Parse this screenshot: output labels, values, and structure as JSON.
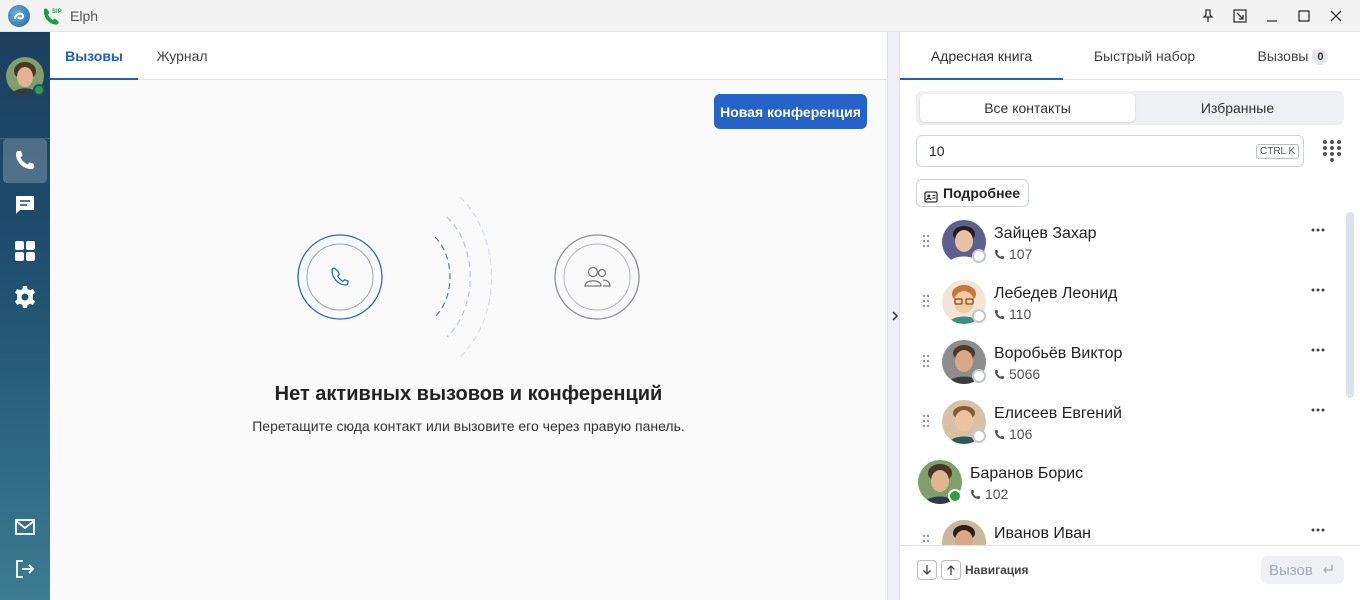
{
  "window": {
    "title": "Elph"
  },
  "center": {
    "tabs": [
      {
        "label": "Вызовы"
      },
      {
        "label": "Журнал"
      }
    ],
    "new_conference_label": "Новая конференция",
    "empty_title": "Нет активных вызовов и конференций",
    "empty_subtitle": "Перетащите сюда контакт или вызовите его через правую панель."
  },
  "right": {
    "tabs": [
      {
        "label": "Адресная книга"
      },
      {
        "label": "Быстрый набор"
      },
      {
        "label": "Вызовы",
        "badge": "0"
      }
    ],
    "segment": [
      {
        "label": "Все контакты"
      },
      {
        "label": "Избранные"
      }
    ],
    "search": {
      "value": "10",
      "shortcut": "CTRL K"
    },
    "details_label": "Подробнее",
    "contacts": [
      {
        "name": "Зайцев Захар",
        "ext": "107",
        "status": "offline"
      },
      {
        "name": "Лебедев Леонид",
        "ext": "110",
        "status": "offline"
      },
      {
        "name": "Воробьёв Виктор",
        "ext": "5066",
        "status": "offline"
      },
      {
        "name": "Елисеев Евгений",
        "ext": "106",
        "status": "offline"
      },
      {
        "name": "Баранов Борис",
        "ext": "102",
        "status": "online"
      },
      {
        "name": "Иванов Иван",
        "ext": "",
        "status": "offline"
      }
    ],
    "footer": {
      "navigation_label": "Навигация",
      "call_label": "Вызов"
    }
  },
  "colors": {
    "accent": "#2563c9",
    "online": "#2e9e48",
    "sidebar_top": "#1d3f5e",
    "sidebar_bottom": "#3c7c90"
  },
  "icons": {
    "sidebar": [
      "phone-icon",
      "chat-icon",
      "apps-icon",
      "gear-icon",
      "mail-icon",
      "logout-icon"
    ],
    "titlebar": [
      "pin-icon",
      "picture-in-picture-icon",
      "minimize-icon",
      "maximize-icon",
      "close-icon"
    ]
  }
}
